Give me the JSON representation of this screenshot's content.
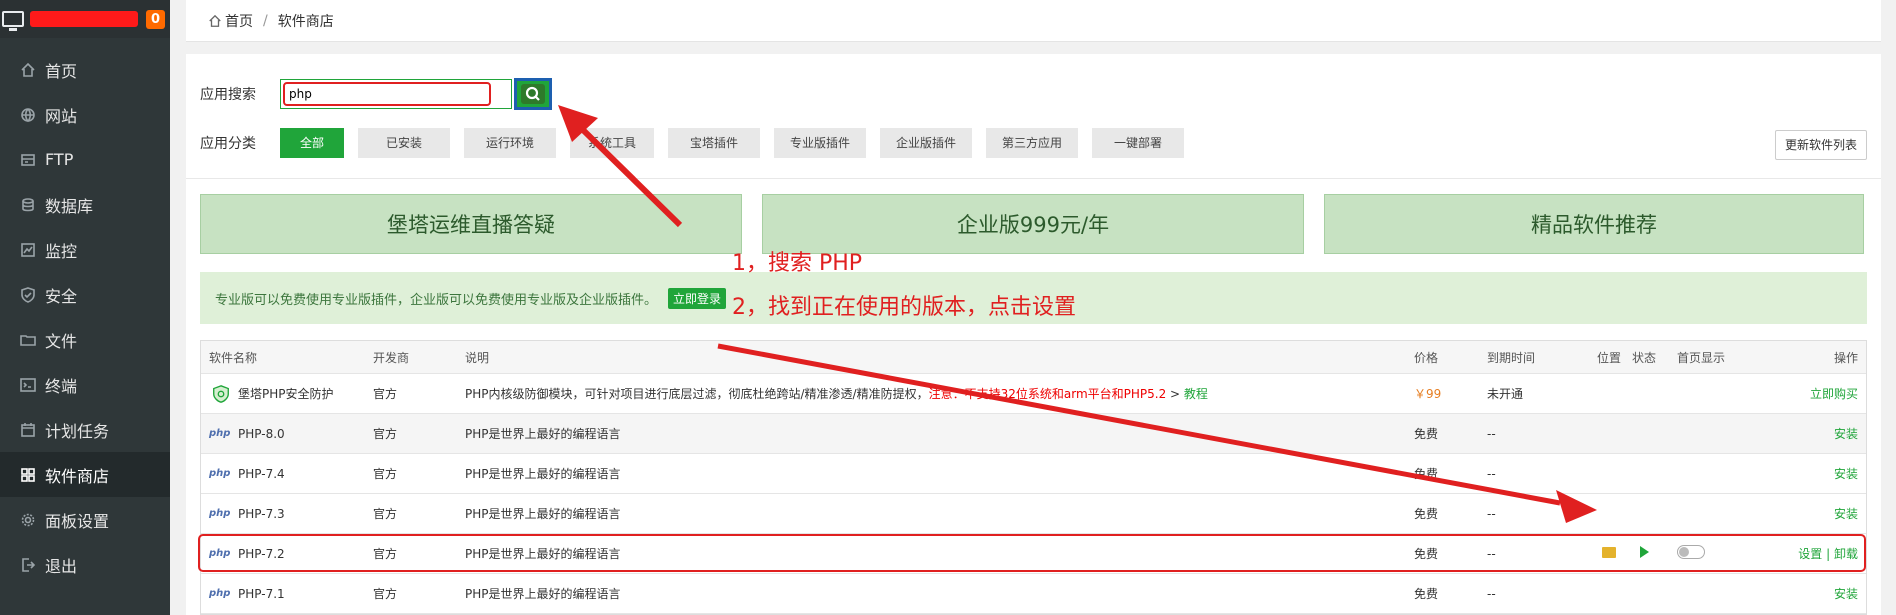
{
  "sidebar": {
    "badge": "0",
    "items": [
      {
        "label": "首页",
        "icon": "home-icon"
      },
      {
        "label": "网站",
        "icon": "globe-icon"
      },
      {
        "label": "FTP",
        "icon": "ftp-icon"
      },
      {
        "label": "数据库",
        "icon": "database-icon"
      },
      {
        "label": "监控",
        "icon": "monitor-icon"
      },
      {
        "label": "安全",
        "icon": "shield-icon"
      },
      {
        "label": "文件",
        "icon": "folder-icon"
      },
      {
        "label": "终端",
        "icon": "terminal-icon"
      },
      {
        "label": "计划任务",
        "icon": "calendar-icon"
      },
      {
        "label": "软件商店",
        "icon": "grid-icon"
      },
      {
        "label": "面板设置",
        "icon": "gear-icon"
      },
      {
        "label": "退出",
        "icon": "logout-icon"
      }
    ]
  },
  "breadcrumb": {
    "home": "首页",
    "sep": "/",
    "current": "软件商店"
  },
  "search": {
    "label": "应用搜索",
    "value": "php"
  },
  "categories": {
    "label": "应用分类",
    "items": [
      "全部",
      "已安装",
      "运行环境",
      "系统工具",
      "宝塔插件",
      "专业版插件",
      "企业版插件",
      "第三方应用",
      "一键部署"
    ],
    "refresh": "更新软件列表"
  },
  "banners": [
    "堡塔运维直播答疑",
    "企业版999元/年",
    "精品软件推荐"
  ],
  "notice": {
    "text": "专业版可以免费使用专业版插件，企业版可以免费使用专业版及企业版插件。",
    "login": "立即登录"
  },
  "table": {
    "headers": [
      "软件名称",
      "开发商",
      "说明",
      "价格",
      "到期时间",
      "位置",
      "状态",
      "首页显示",
      "操作"
    ],
    "rows": [
      {
        "name": "堡塔PHP安全防护",
        "dev": "官方",
        "desc": "PHP内核级防御模块，可针对项目进行底层过滤，彻底杜绝跨站/精准渗透/精准防提权，",
        "warn_prefix": "注意：",
        "warn": "不支持32位系统和arm平台和PHP5.2",
        "gt": " > ",
        "tutorial": "教程",
        "price": "￥99",
        "expire": "未开通",
        "action": "立即购买"
      },
      {
        "name": "PHP-8.0",
        "dev": "官方",
        "desc": "PHP是世界上最好的编程语言",
        "price": "免费",
        "expire": "--",
        "action": "安装"
      },
      {
        "name": "PHP-7.4",
        "dev": "官方",
        "desc": "PHP是世界上最好的编程语言",
        "price": "免费",
        "expire": "--",
        "action": "安装"
      },
      {
        "name": "PHP-7.3",
        "dev": "官方",
        "desc": "PHP是世界上最好的编程语言",
        "price": "免费",
        "expire": "--",
        "action": "安装"
      },
      {
        "name": "PHP-7.2",
        "dev": "官方",
        "desc": "PHP是世界上最好的编程语言",
        "price": "免费",
        "expire": "--",
        "action_set": "设置",
        "action_sep": " | ",
        "action_uninstall": "卸载"
      },
      {
        "name": "PHP-7.1",
        "dev": "官方",
        "desc": "PHP是世界上最好的编程语言",
        "price": "免费",
        "expire": "--",
        "action": "安装"
      }
    ]
  },
  "annotations": {
    "step1": "1，搜索 PHP",
    "step2": "2，找到正在使用的版本，点击设置"
  },
  "colors": {
    "accent": "#20a53a",
    "annotation": "#e02020",
    "sidebar": "#2f3739"
  }
}
